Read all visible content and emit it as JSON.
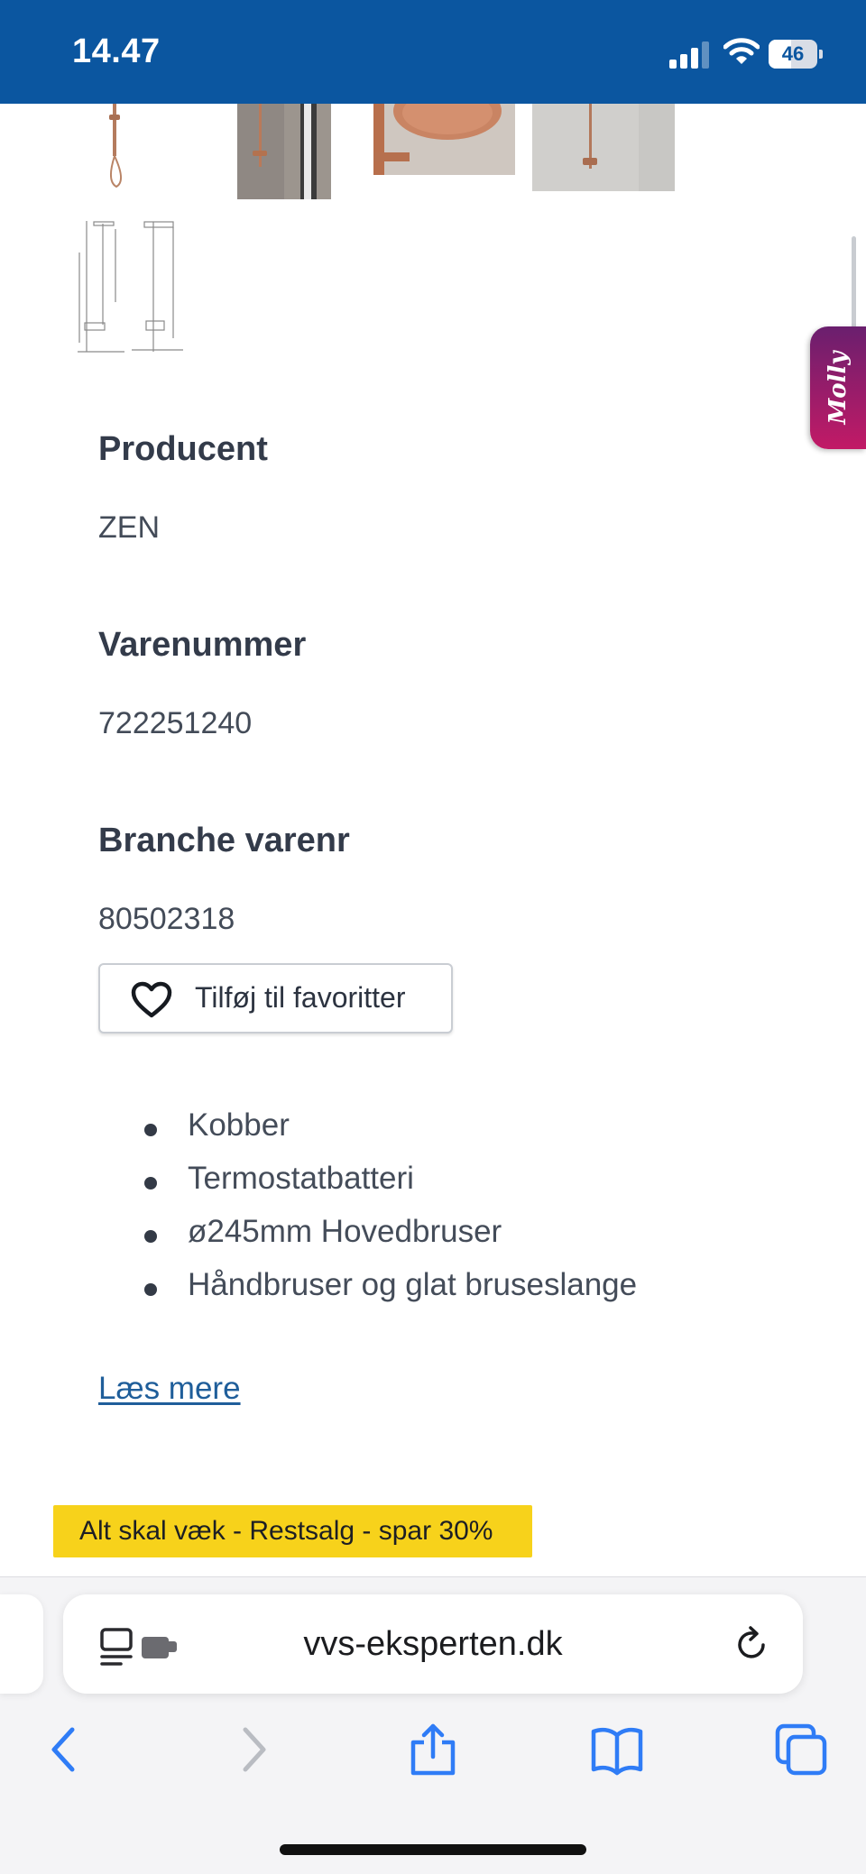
{
  "status_bar": {
    "time": "14.47",
    "battery_level": "46",
    "battery_fraction": 0.46,
    "signal_bars_active": 3,
    "signal_bars_total": 4
  },
  "colors": {
    "status_bar": "#0b56a0",
    "promo_banner": "#f7d21b",
    "link": "#1f5e9a",
    "heading": "#333b4a",
    "safari_blue": "#2f7cf6",
    "molly_tab_top": "#6a1f6e",
    "molly_tab_bottom": "#c21a66"
  },
  "gallery": {
    "thumbnails": [
      {
        "icon": "shower-system-image"
      },
      {
        "icon": "shower-installed-image"
      },
      {
        "icon": "shower-head-closeup-image"
      },
      {
        "icon": "hand-shower-image"
      },
      {
        "icon": "technical-drawing-image"
      }
    ]
  },
  "molly": {
    "label": "Molly"
  },
  "product": {
    "specs": [
      {
        "label": "Producent",
        "value": "ZEN"
      },
      {
        "label": "Varenummer",
        "value": "722251240"
      },
      {
        "label": "Branche varenr",
        "value": "80502318"
      }
    ],
    "favorite_button": {
      "label": "Tilføj til favoritter",
      "icon": "heart-icon"
    },
    "features": [
      "Kobber",
      "Termostatbatteri",
      "ø245mm Hovedbruser",
      "Håndbruser og glat bruseslange"
    ],
    "read_more": "Læs mere"
  },
  "promo": {
    "label": "Alt skal væk - Restsalg - spar 30%"
  },
  "browser": {
    "url": "vvs-eksperten.dk",
    "toolbar": {
      "back": "chevron-left-icon",
      "forward": "chevron-right-icon",
      "share": "share-icon",
      "bookmarks": "book-icon",
      "tabs": "tabs-icon"
    }
  }
}
